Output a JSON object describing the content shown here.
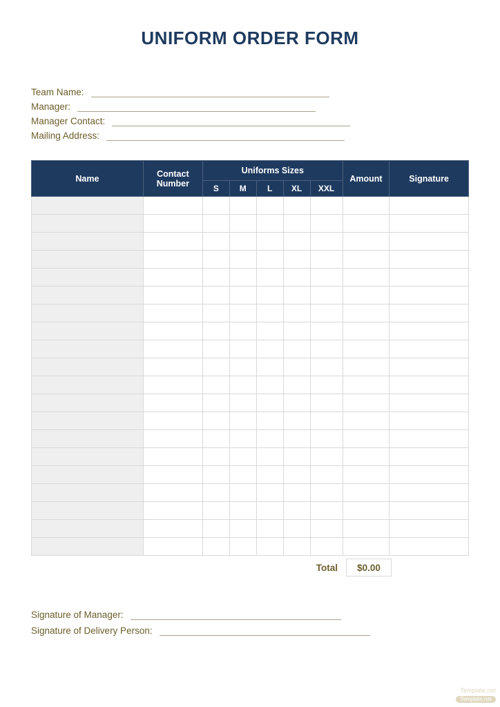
{
  "title": "UNIFORM ORDER FORM",
  "info_labels": {
    "team_name": "Team Name:",
    "manager": "Manager:",
    "manager_contact": "Manager Contact:",
    "mailing_address": "Mailing Address:"
  },
  "table": {
    "headers": {
      "name": "Name",
      "contact": "Contact Number",
      "sizes_group": "Uniforms Sizes",
      "sizes": [
        "S",
        "M",
        "L",
        "XL",
        "XXL"
      ],
      "amount": "Amount",
      "signature": "Signature"
    },
    "row_count": 20
  },
  "total": {
    "label": "Total",
    "value": "$0.00"
  },
  "signatures": {
    "manager": "Signature of Manager:",
    "delivery": "Signature of Delivery  Person:"
  },
  "watermark": {
    "text": "Template.net",
    "pill": "Template.net"
  }
}
